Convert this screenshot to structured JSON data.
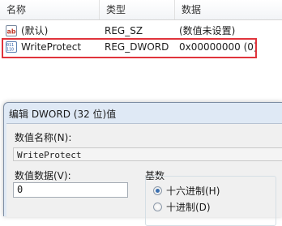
{
  "list": {
    "columns": [
      "名称",
      "类型",
      "数据"
    ],
    "rows": [
      {
        "name": "(默认)",
        "type": "REG_SZ",
        "data": "(数值未设置)",
        "icon": "string-value-icon"
      },
      {
        "name": "WriteProtect",
        "type": "REG_DWORD",
        "data": "0x00000000 (0)",
        "icon": "binary-value-icon"
      }
    ]
  },
  "dialog": {
    "title": "编辑 DWORD (32 位)值",
    "name_label": "数值名称(N):",
    "name_value": "WriteProtect",
    "data_label": "数值数据(V):",
    "data_value": "0",
    "base_label": "基数",
    "radio_hex": "十六进制(H)",
    "radio_dec": "十进制(D)"
  },
  "colors": {
    "highlight": "#e0343c",
    "dialog_frame": "#dfe9f5"
  }
}
